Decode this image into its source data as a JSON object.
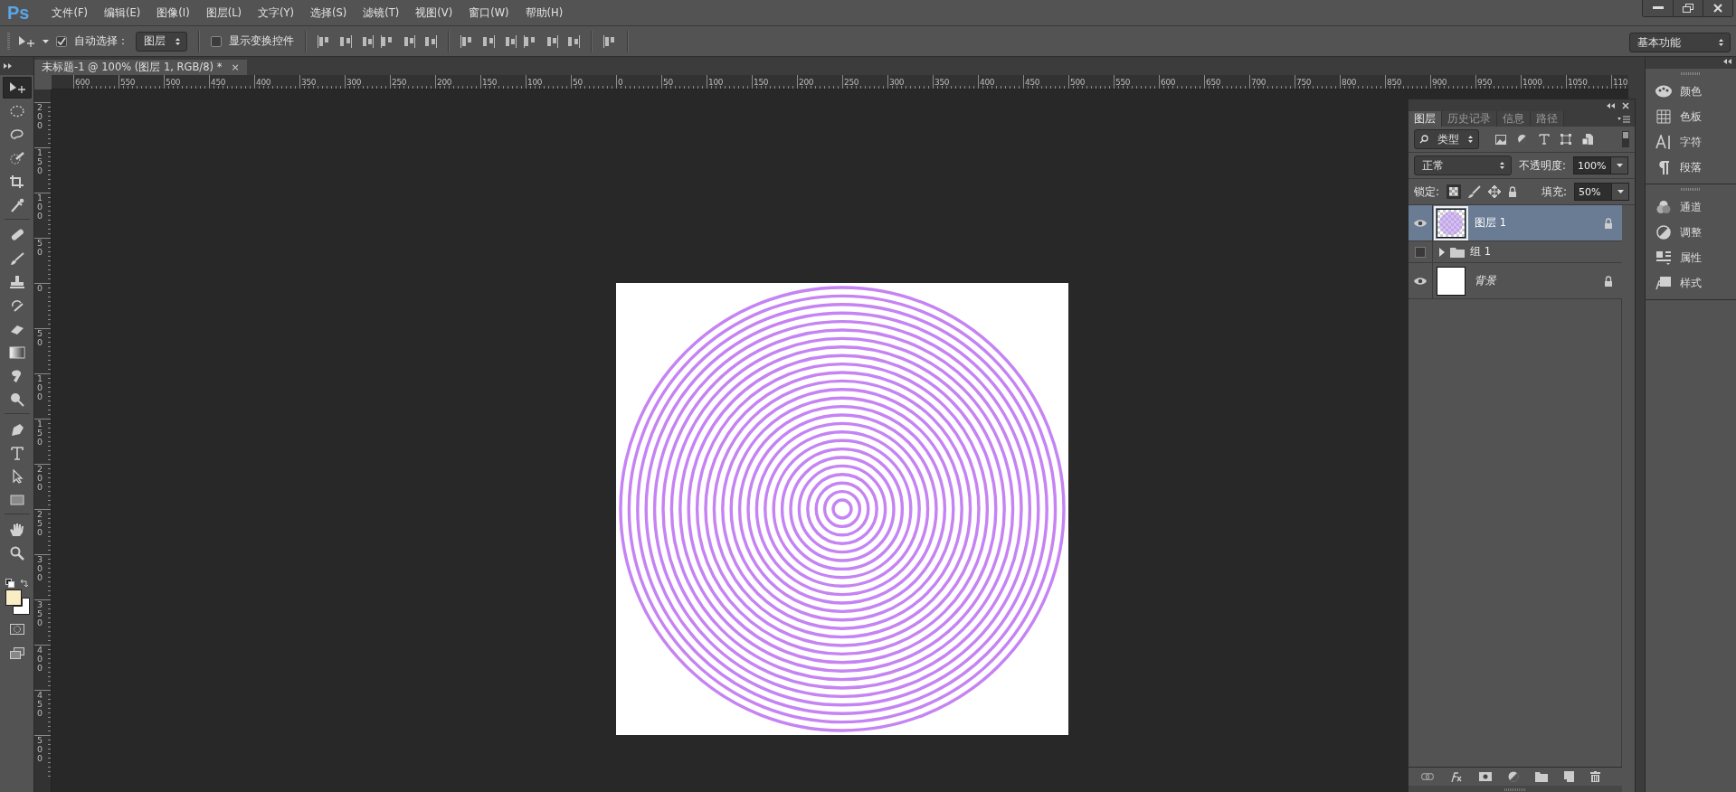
{
  "app": {
    "logo": "Ps"
  },
  "menu": [
    "文件(F)",
    "编辑(E)",
    "图像(I)",
    "图层(L)",
    "文字(Y)",
    "选择(S)",
    "滤镜(T)",
    "视图(V)",
    "窗口(W)",
    "帮助(H)"
  ],
  "options_bar": {
    "auto_select": {
      "label": "自动选择：",
      "checked": true
    },
    "auto_select_target": "图层",
    "show_transform": {
      "label": "显示变换控件",
      "checked": false
    }
  },
  "workspace": "基本功能",
  "document_tab": {
    "title": "未标题-1 @ 100% (图层 1, RGB/8) *",
    "close": "×"
  },
  "rulers": {
    "horizontal": [
      "600",
      "550",
      "500",
      "450",
      "400",
      "350",
      "300",
      "250",
      "200",
      "150",
      "100",
      "50",
      "0",
      "50",
      "100",
      "150",
      "200",
      "250",
      "300",
      "350",
      "400",
      "450",
      "500",
      "550",
      "600",
      "650",
      "700",
      "750",
      "800",
      "850",
      "900",
      "950",
      "1000",
      "1050",
      "110"
    ],
    "vertical": [
      "200",
      "150",
      "100",
      "50",
      "0",
      "50",
      "100",
      "150",
      "200",
      "250",
      "300",
      "350",
      "400",
      "450",
      "500"
    ]
  },
  "tools": [
    {
      "kind": "move",
      "selected": true
    },
    {
      "kind": "marquee",
      "selected": false
    },
    {
      "kind": "lasso",
      "selected": false
    },
    {
      "kind": "quick-select",
      "selected": false
    },
    {
      "kind": "crop",
      "selected": false
    },
    {
      "kind": "eyedropper",
      "selected": false
    },
    {
      "kind": "healing",
      "selected": false
    },
    {
      "kind": "brush",
      "selected": false
    },
    {
      "kind": "stamp",
      "selected": false
    },
    {
      "kind": "history-brush",
      "selected": false
    },
    {
      "kind": "eraser",
      "selected": false
    },
    {
      "kind": "gradient",
      "selected": false
    },
    {
      "kind": "blur",
      "selected": false
    },
    {
      "kind": "dodge",
      "selected": false
    },
    {
      "kind": "pen",
      "selected": false
    },
    {
      "kind": "type",
      "selected": false
    },
    {
      "kind": "path-select",
      "selected": false
    },
    {
      "kind": "rectangle",
      "selected": false
    },
    {
      "kind": "hand",
      "selected": false
    },
    {
      "kind": "zoom",
      "selected": false
    }
  ],
  "swatches": [
    {
      "kind": "foreground",
      "color": "#f9edc6"
    },
    {
      "kind": "background",
      "color": "#ffffff"
    }
  ],
  "layers_panel": {
    "tabs": [
      {
        "label": "图层",
        "selected": true
      },
      {
        "label": "历史记录",
        "selected": false
      },
      {
        "label": "信息",
        "selected": false
      },
      {
        "label": "路径",
        "selected": false
      }
    ],
    "filter": "类型",
    "filter_toggle": {
      "on": false
    },
    "blend_mode": "正常",
    "opacity_label": "不透明度:",
    "opacity": "100%",
    "lock_label": "锁定:",
    "fill_label": "填充:",
    "fill": "50%",
    "layers": [
      {
        "kind": "pixel",
        "name": "图层 1",
        "visible": true,
        "selected": true,
        "locked": true
      },
      {
        "kind": "group",
        "name": "组 1",
        "visible": false,
        "selected": false,
        "locked": false,
        "expanded": false
      },
      {
        "kind": "background",
        "name": "背景",
        "visible": true,
        "selected": false,
        "locked": true
      }
    ]
  },
  "dock_groups": [
    {
      "items": [
        {
          "kind": "color",
          "label": "颜色"
        },
        {
          "kind": "swatches",
          "label": "色板"
        },
        {
          "kind": "character",
          "label": "字符"
        },
        {
          "kind": "paragraph",
          "label": "段落"
        }
      ]
    },
    {
      "items": [
        {
          "kind": "channels",
          "label": "通道"
        },
        {
          "kind": "adjustments",
          "label": "调整"
        },
        {
          "kind": "properties",
          "label": "属性"
        },
        {
          "kind": "styles",
          "label": "样式"
        }
      ]
    }
  ]
}
